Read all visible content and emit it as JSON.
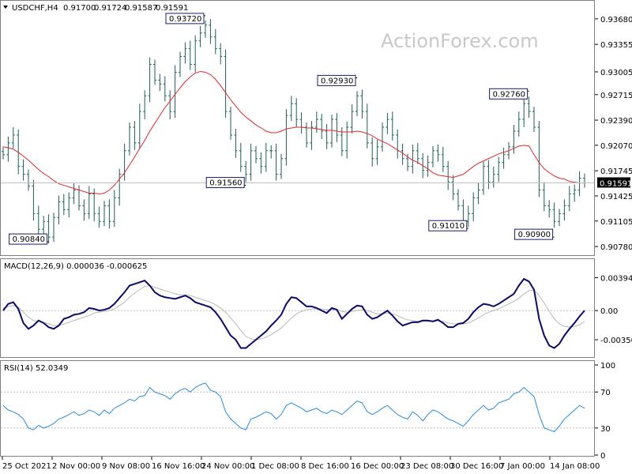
{
  "header": {
    "symbol": "USDCHF,H4",
    "open": "0.91700",
    "high": "0.91724",
    "low": "0.91587",
    "close": "0.91591"
  },
  "watermark": "ActionForex.com",
  "colors": {
    "bull": "#1f5d57",
    "bear": "#1f5d57",
    "ma": "#e0282f",
    "macd_main": "#0a0a6a",
    "macd_signal": "#b8b8b8",
    "rsi": "#2a8ad8",
    "grid": "#c0c0c0",
    "frame": "#808080"
  },
  "panels": {
    "macd_label": "MACD(12,26,9) 0.000036 -0.000625",
    "rsi_label": "RSI(14) 52.0349"
  },
  "axes": {
    "price_ticks": [
      "0.93680",
      "0.93355",
      "0.93005",
      "0.92715",
      "0.92390",
      "0.92070",
      "0.91745",
      "0.91425",
      "0.91105",
      "0.90780"
    ],
    "price_tick_values": [
      0.9368,
      0.93355,
      0.93005,
      0.92715,
      0.9239,
      0.9207,
      0.91745,
      0.91425,
      0.91105,
      0.9078
    ],
    "current_price": "0.91591",
    "macd_ticks": [
      "0.003944",
      "0.00",
      "-0.003506"
    ],
    "rsi_ticks": [
      "100",
      "70",
      "30",
      "0"
    ],
    "time_labels": [
      "25 Oct 2021",
      "2 Nov 00:00",
      "9 Nov 08:00",
      "16 Nov 16:00",
      "24 Nov 00:00",
      "1 Dec 08:00",
      "8 Dec 16:00",
      "16 Dec 00:00",
      "23 Dec 08:00",
      "30 Dec 16:00",
      "7 Jan 00:00",
      "14 Jan 08:00"
    ]
  },
  "annotations": [
    {
      "label": "0.93720",
      "value": 0.9372,
      "bar": 40
    },
    {
      "label": "0.90840",
      "value": 0.9084,
      "bar": 9
    },
    {
      "label": "0.91560",
      "value": 0.9156,
      "bar": 48
    },
    {
      "label": "0.92930",
      "value": 0.9293,
      "bar": 70
    },
    {
      "label": "0.91010",
      "value": 0.9101,
      "bar": 92
    },
    {
      "label": "0.92760",
      "value": 0.9276,
      "bar": 104
    },
    {
      "label": "0.90900",
      "value": 0.909,
      "bar": 109
    }
  ],
  "chart_data": {
    "type": "line",
    "title": "USDCHF,H4",
    "ylim": [
      0.9068,
      0.9388
    ],
    "close": [
      0.9195,
      0.921,
      0.922,
      0.918,
      0.917,
      0.9155,
      0.912,
      0.91,
      0.911,
      0.909,
      0.9115,
      0.9135,
      0.9125,
      0.914,
      0.915,
      0.913,
      0.912,
      0.9145,
      0.912,
      0.911,
      0.913,
      0.911,
      0.914,
      0.917,
      0.92,
      0.923,
      0.921,
      0.925,
      0.927,
      0.931,
      0.929,
      0.9285,
      0.927,
      0.925,
      0.93,
      0.932,
      0.933,
      0.931,
      0.934,
      0.935,
      0.936,
      0.9345,
      0.933,
      0.932,
      0.925,
      0.922,
      0.92,
      0.918,
      0.917,
      0.92,
      0.919,
      0.918,
      0.92,
      0.92,
      0.917,
      0.919,
      0.9245,
      0.926,
      0.924,
      0.923,
      0.921,
      0.923,
      0.924,
      0.9225,
      0.921,
      0.924,
      0.922,
      0.92,
      0.923,
      0.925,
      0.927,
      0.925,
      0.921,
      0.919,
      0.9205,
      0.923,
      0.924,
      0.922,
      0.92,
      0.919,
      0.918,
      0.92,
      0.919,
      0.9175,
      0.9185,
      0.92,
      0.9195,
      0.918,
      0.916,
      0.9145,
      0.913,
      0.911,
      0.912,
      0.914,
      0.915,
      0.918,
      0.916,
      0.917,
      0.9185,
      0.9195,
      0.9205,
      0.9225,
      0.924,
      0.926,
      0.925,
      0.923,
      0.915,
      0.913,
      0.9125,
      0.911,
      0.912,
      0.913,
      0.9145,
      0.915,
      0.9165,
      0.9159
    ],
    "ma": [
      0.9205,
      0.9204,
      0.9202,
      0.9198,
      0.9193,
      0.9188,
      0.9182,
      0.9176,
      0.9171,
      0.9167,
      0.9162,
      0.9158,
      0.9156,
      0.9154,
      0.9152,
      0.915,
      0.9148,
      0.9146,
      0.9146,
      0.9145,
      0.9146,
      0.915,
      0.9156,
      0.9164,
      0.9172,
      0.9182,
      0.9192,
      0.9203,
      0.9213,
      0.9225,
      0.9235,
      0.9245,
      0.9255,
      0.9263,
      0.9272,
      0.928,
      0.9288,
      0.9294,
      0.9299,
      0.9301,
      0.93,
      0.9297,
      0.9291,
      0.9283,
      0.9274,
      0.9265,
      0.9257,
      0.9249,
      0.9243,
      0.9238,
      0.9233,
      0.9229,
      0.9225,
      0.9223,
      0.9223,
      0.9225,
      0.9228,
      0.9229,
      0.923,
      0.923,
      0.9229,
      0.9229,
      0.9228,
      0.9227,
      0.9226,
      0.9226,
      0.9225,
      0.9224,
      0.9224,
      0.9224,
      0.9225,
      0.9224,
      0.9222,
      0.9219,
      0.9215,
      0.9212,
      0.9209,
      0.9205,
      0.9201,
      0.9197,
      0.9192,
      0.9188,
      0.9185,
      0.9181,
      0.9177,
      0.9172,
      0.9169,
      0.9168,
      0.9167,
      0.9166,
      0.9168,
      0.917,
      0.9175,
      0.918,
      0.9184,
      0.9187,
      0.919,
      0.9193,
      0.9196,
      0.9198,
      0.92,
      0.9203,
      0.9206,
      0.9207,
      0.9206,
      0.9195,
      0.9185,
      0.9177,
      0.9172,
      0.9168,
      0.9165,
      0.9164,
      0.9161,
      0.916,
      0.9159,
      0.9159
    ],
    "macd_main": [
      0.0,
      0.0008,
      0.001,
      0.0002,
      -0.0015,
      -0.0022,
      -0.0018,
      -0.0012,
      -0.0015,
      -0.002,
      -0.0022,
      -0.0018,
      -0.001,
      -0.0008,
      -0.0005,
      -0.0004,
      -0.0002,
      0.0003,
      0.0002,
      0.0,
      0.0001,
      0.0003,
      0.0008,
      0.0015,
      0.0022,
      0.003,
      0.0032,
      0.0034,
      0.0036,
      0.003,
      0.0022,
      0.0018,
      0.0016,
      0.0015,
      0.0014,
      0.0016,
      0.0018,
      0.0015,
      0.001,
      0.0008,
      0.0006,
      0.0004,
      -0.0002,
      -0.001,
      -0.002,
      -0.003,
      -0.0035,
      -0.0045,
      -0.0045,
      -0.004,
      -0.0035,
      -0.003,
      -0.0025,
      -0.0018,
      -0.0012,
      -0.0005,
      0.0008,
      0.0016,
      0.0015,
      0.001,
      0.0005,
      0.0005,
      0.0003,
      0.0,
      -0.0003,
      0.0003,
      0.0001,
      -0.001,
      -0.0004,
      0.0002,
      0.0006,
      0.0005,
      -0.0005,
      -0.001,
      -0.0008,
      -0.0004,
      0.0,
      -0.0006,
      -0.0013,
      -0.0018,
      -0.0016,
      -0.0014,
      -0.0014,
      -0.0012,
      -0.0012,
      -0.0013,
      -0.0011,
      -0.0015,
      -0.002,
      -0.002,
      -0.0016,
      -0.0015,
      -0.001,
      -0.0002,
      0.0004,
      0.0008,
      0.0007,
      0.0005,
      0.0008,
      0.0012,
      0.0016,
      0.002,
      0.003,
      0.0038,
      0.0035,
      0.0025,
      -0.001,
      -0.003,
      -0.0042,
      -0.0045,
      -0.004,
      -0.003,
      -0.0022,
      -0.0015,
      -0.0007,
      0.0
    ],
    "macd_signal": [
      0.0003,
      0.0005,
      0.0006,
      0.0004,
      -0.0002,
      -0.0008,
      -0.0012,
      -0.0013,
      -0.0014,
      -0.0016,
      -0.0018,
      -0.0018,
      -0.0016,
      -0.0014,
      -0.0012,
      -0.001,
      -0.0008,
      -0.0006,
      -0.0003,
      -0.0002,
      -0.0001,
      0.0,
      0.0002,
      0.0006,
      0.001,
      0.0016,
      0.0021,
      0.0025,
      0.0029,
      0.003,
      0.0028,
      0.0026,
      0.0024,
      0.0022,
      0.002,
      0.0019,
      0.0019,
      0.0018,
      0.0016,
      0.0014,
      0.0012,
      0.001,
      0.0007,
      0.0003,
      -0.0002,
      -0.0009,
      -0.0016,
      -0.0024,
      -0.0031,
      -0.0034,
      -0.0035,
      -0.0034,
      -0.0032,
      -0.0029,
      -0.0025,
      -0.0021,
      -0.0015,
      -0.0009,
      -0.0004,
      -0.0001,
      0.0001,
      0.0002,
      0.0002,
      0.0002,
      0.0001,
      0.0001,
      0.0001,
      -0.0001,
      -0.0002,
      -0.0001,
      0.0,
      0.0001,
      0.0,
      -0.0002,
      -0.0004,
      -0.0004,
      -0.0003,
      -0.0004,
      -0.0006,
      -0.0009,
      -0.0011,
      -0.0012,
      -0.0013,
      -0.0013,
      -0.0013,
      -0.0013,
      -0.0013,
      -0.0013,
      -0.0015,
      -0.0016,
      -0.0016,
      -0.0016,
      -0.0015,
      -0.0012,
      -0.0009,
      -0.0005,
      -0.0002,
      0.0,
      0.0002,
      0.0005,
      0.0008,
      0.0011,
      0.0015,
      0.002,
      0.0024,
      0.0025,
      0.0018,
      0.0009,
      -0.0001,
      -0.001,
      -0.0016,
      -0.0019,
      -0.002,
      -0.0019,
      -0.0017,
      -0.0013
    ],
    "rsi": [
      55,
      50,
      48,
      45,
      40,
      30,
      28,
      33,
      30,
      32,
      35,
      40,
      42,
      45,
      48,
      44,
      46,
      50,
      48,
      44,
      50,
      46,
      52,
      55,
      58,
      62,
      60,
      65,
      66,
      75,
      70,
      68,
      66,
      62,
      68,
      72,
      74,
      70,
      75,
      78,
      80,
      72,
      70,
      65,
      48,
      40,
      35,
      30,
      28,
      40,
      42,
      45,
      48,
      46,
      40,
      45,
      55,
      58,
      55,
      52,
      48,
      50,
      52,
      48,
      46,
      50,
      48,
      45,
      50,
      55,
      60,
      58,
      48,
      45,
      48,
      52,
      55,
      50,
      45,
      42,
      40,
      48,
      44,
      38,
      45,
      50,
      48,
      44,
      40,
      38,
      35,
      32,
      38,
      45,
      50,
      55,
      50,
      52,
      58,
      60,
      62,
      68,
      70,
      75,
      70,
      65,
      45,
      30,
      28,
      26,
      32,
      40,
      45,
      50,
      55,
      52
    ],
    "rsi_levels": [
      70,
      30
    ],
    "macd_ylim": [
      -0.0054,
      0.0058
    ],
    "rsi_ylim": [
      0,
      100
    ]
  }
}
